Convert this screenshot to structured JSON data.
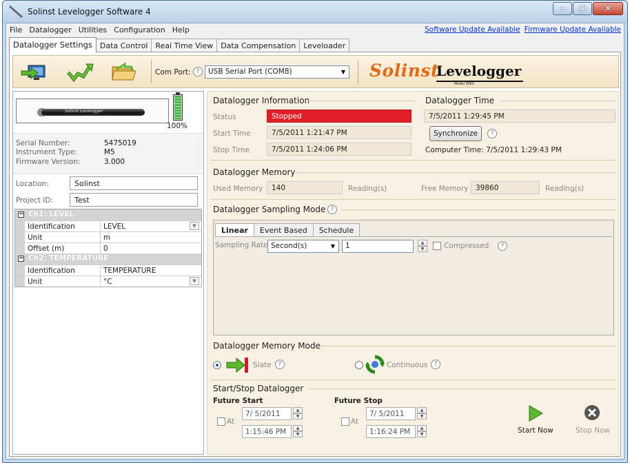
{
  "window": {
    "title": "Solinst Levelogger Software 4"
  },
  "menu": {
    "items": [
      "File",
      "Datalogger",
      "Utilities",
      "Configuration",
      "Help"
    ],
    "software_update": "Software Update Available",
    "firmware_update": "Firmware Update Available"
  },
  "tabs": [
    "Datalogger Settings",
    "Data Control",
    "Real Time View",
    "Data Compensation",
    "Leveloader"
  ],
  "toolbar": {
    "com_port_label": "Com Port:",
    "com_port_value": "USB Serial Port (COM8)",
    "brand_solinst": "Solinst",
    "brand_levelogger": "Levelogger",
    "brand_model": "Model 3001"
  },
  "device": {
    "logger_text": "Solinst Levelogger",
    "battery_pct": "100%",
    "battery_level": 1.0,
    "serial_label": "Serial Number:",
    "serial_value": "5475019",
    "type_label": "Instrument Type:",
    "type_value": "M5",
    "firmware_label": "Firmware Version:",
    "firmware_value": "3.000",
    "location_label": "Location:",
    "location_value": "Solinst",
    "project_label": "Project ID:",
    "project_value": "Test"
  },
  "channels": {
    "ch1_title": "Ch1: LEVEL",
    "ch1_rows": [
      {
        "k": "Identification",
        "v": "LEVEL"
      },
      {
        "k": "Unit",
        "v": "m"
      },
      {
        "k": "Offset (m)",
        "v": "0"
      }
    ],
    "ch2_title": "Ch2: TEMPERATURE",
    "ch2_rows": [
      {
        "k": "Identification",
        "v": "TEMPERATURE"
      },
      {
        "k": "Unit",
        "v": "°C"
      }
    ]
  },
  "info": {
    "title": "Datalogger Information",
    "status_label": "Status",
    "status_value": "Stopped",
    "start_label": "Start Time",
    "start_value": "7/5/2011 1:21:47 PM",
    "stop_label": "Stop Time",
    "stop_value": "7/5/2011 1:24:06 PM"
  },
  "time": {
    "title": "Datalogger Time",
    "value": "7/5/2011 1:29:45 PM",
    "sync_label": "Synchronize",
    "computer_time": "Computer Time: 7/5/2011 1:29:43 PM"
  },
  "memory": {
    "title": "Datalogger Memory",
    "used_label": "Used Memory",
    "used_value": "140",
    "used_unit": "Reading(s)",
    "free_label": "Free Memory",
    "free_value": "39860",
    "free_unit": "Reading(s)"
  },
  "sampling": {
    "title": "Datalogger Sampling Mode",
    "tabs": [
      "Linear",
      "Event Based",
      "Schedule"
    ],
    "rate_label": "Sampling Rate",
    "rate_unit": "Second(s)",
    "rate_value": "1",
    "compressed_label": "Compressed"
  },
  "memory_mode": {
    "title": "Datalogger Memory Mode",
    "slate_label": "Slate",
    "continuous_label": "Continuous"
  },
  "startstop": {
    "title": "Start/Stop Datalogger",
    "future_start": "Future Start",
    "future_stop": "Future Stop",
    "at_label": "At",
    "start_date": "7/ 5/2011",
    "start_time": "1:15:46 PM",
    "stop_date": "7/ 5/2011",
    "stop_time": "1:16:24 PM",
    "start_now": "Start Now",
    "stop_now": "Stop Now"
  },
  "help_glyph": "?",
  "colors": {
    "status_red": "#e01f27",
    "brand_orange": "#e26a14",
    "link_blue": "#0033cc"
  }
}
